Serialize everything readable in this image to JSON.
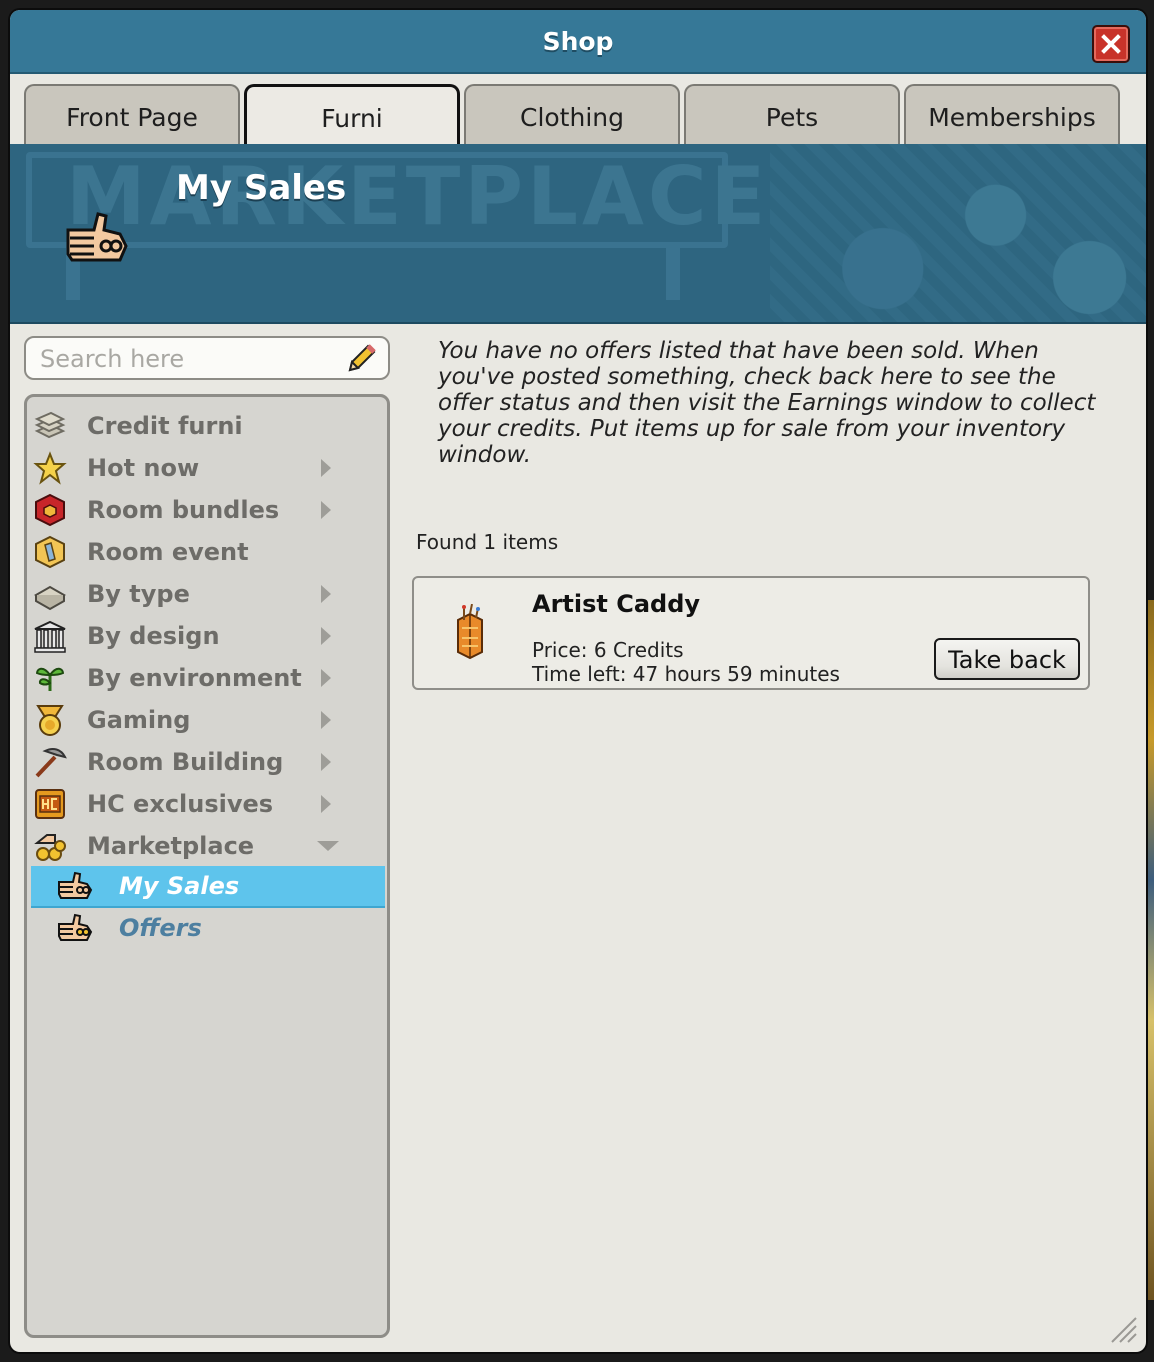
{
  "window": {
    "title": "Shop"
  },
  "tabs": [
    {
      "label": "Front Page"
    },
    {
      "label": "Furni",
      "active": true
    },
    {
      "label": "Clothing"
    },
    {
      "label": "Pets"
    },
    {
      "label": "Memberships"
    }
  ],
  "banner": {
    "background_text": "MARKETPLACE",
    "title": "My Sales",
    "icon": "pointing-hand-icon"
  },
  "search": {
    "placeholder": "Search here",
    "icon": "pencil-icon"
  },
  "catalog": {
    "items": [
      {
        "label": "Credit furni",
        "icon": "credit-furni-icon",
        "arrow": false
      },
      {
        "label": "Hot now",
        "icon": "star-icon",
        "arrow": true
      },
      {
        "label": "Room bundles",
        "icon": "room-bundle-icon",
        "arrow": true
      },
      {
        "label": "Room event",
        "icon": "room-event-icon",
        "arrow": false
      },
      {
        "label": "By type",
        "icon": "by-type-icon",
        "arrow": true
      },
      {
        "label": "By design",
        "icon": "by-design-icon",
        "arrow": true
      },
      {
        "label": "By environment",
        "icon": "plant-icon",
        "arrow": true
      },
      {
        "label": "Gaming",
        "icon": "medal-icon",
        "arrow": true
      },
      {
        "label": "Room Building",
        "icon": "pickaxe-icon",
        "arrow": true
      },
      {
        "label": "HC exclusives",
        "icon": "hc-icon",
        "arrow": true
      },
      {
        "label": "Marketplace",
        "icon": "marketplace-icon",
        "arrow": "down"
      }
    ],
    "subitems": [
      {
        "label": "My Sales",
        "icon": "pointing-hand-icon",
        "selected": true
      },
      {
        "label": "Offers",
        "icon": "pointing-hand-icon",
        "selected": false
      }
    ]
  },
  "content": {
    "info": "You have no offers listed that have been sold. When you've posted something, check back here to see the offer status and then visit the Earnings window to collect your credits. Put items up for sale from your inventory window.",
    "found": "Found 1 items",
    "offer": {
      "name": "Artist Caddy",
      "price": "Price: 6 Credits",
      "time_left": "Time left: 47 hours 59 minutes",
      "button": "Take back",
      "icon": "artist-caddy-icon"
    }
  },
  "colors": {
    "titlebar": "#367897",
    "banner": "#2e6580",
    "selected_item": "#5ec4ec",
    "close_button": "#c8332a"
  }
}
